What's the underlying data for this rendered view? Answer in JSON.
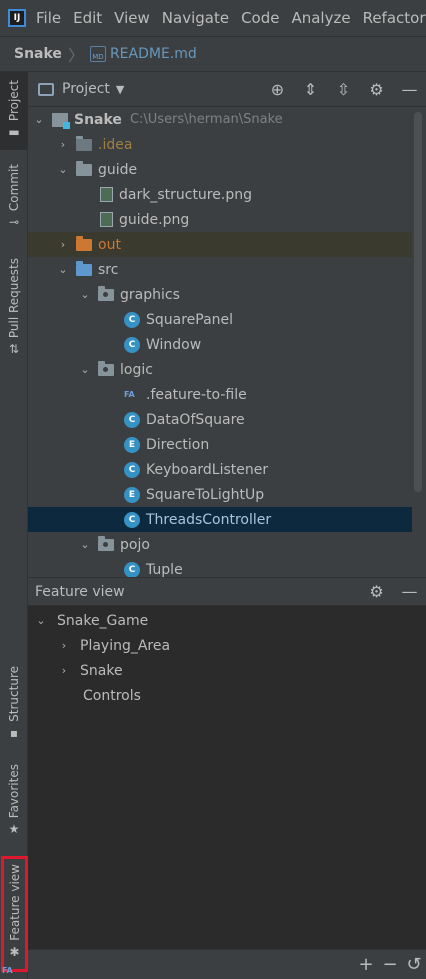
{
  "menubar": {
    "logo": "IJ",
    "items": [
      "File",
      "Edit",
      "View",
      "Navigate",
      "Code",
      "Analyze",
      "Refactor"
    ]
  },
  "breadcrumb": {
    "project": "Snake",
    "file_icon": "MD",
    "file": "README.md"
  },
  "left_tabs": {
    "project": "Project",
    "commit": "Commit",
    "pull_requests": "Pull Requests",
    "structure": "Structure",
    "favorites": "Favorites",
    "feature_view": "Feature view"
  },
  "project_panel": {
    "title": "Project",
    "tree": {
      "root": {
        "name": "Snake",
        "path": "C:\\Users\\herman\\Snake"
      },
      "idea": ".idea",
      "guide": "guide",
      "guide_files": [
        "dark_structure.png",
        "guide.png"
      ],
      "out": "out",
      "src": "src",
      "graphics": "graphics",
      "graphics_classes": [
        "SquarePanel",
        "Window"
      ],
      "logic": "logic",
      "feature_file": ".feature-to-file",
      "logic_classes": [
        "DataOfSquare",
        "Direction",
        "KeyboardListener",
        "SquareToLightUp",
        "ThreadsController"
      ],
      "pojo": "pojo",
      "pojo_classes": [
        "Tuple"
      ]
    },
    "class_badges": [
      "C",
      "C",
      "C",
      "E",
      "C",
      "E",
      "C",
      "C"
    ],
    "fa_badge": "FA"
  },
  "feature_panel": {
    "title": "Feature view",
    "root": "Snake_Game",
    "children": [
      "Playing_Area",
      "Snake",
      "Controls"
    ],
    "logo": "FA"
  },
  "colors": {
    "accent_selection": "#0d293e",
    "highlight_red": "#e0182e",
    "folder_out": "#cc7832",
    "folder_src": "#5e98cf",
    "class_icon": "#3592c4"
  }
}
